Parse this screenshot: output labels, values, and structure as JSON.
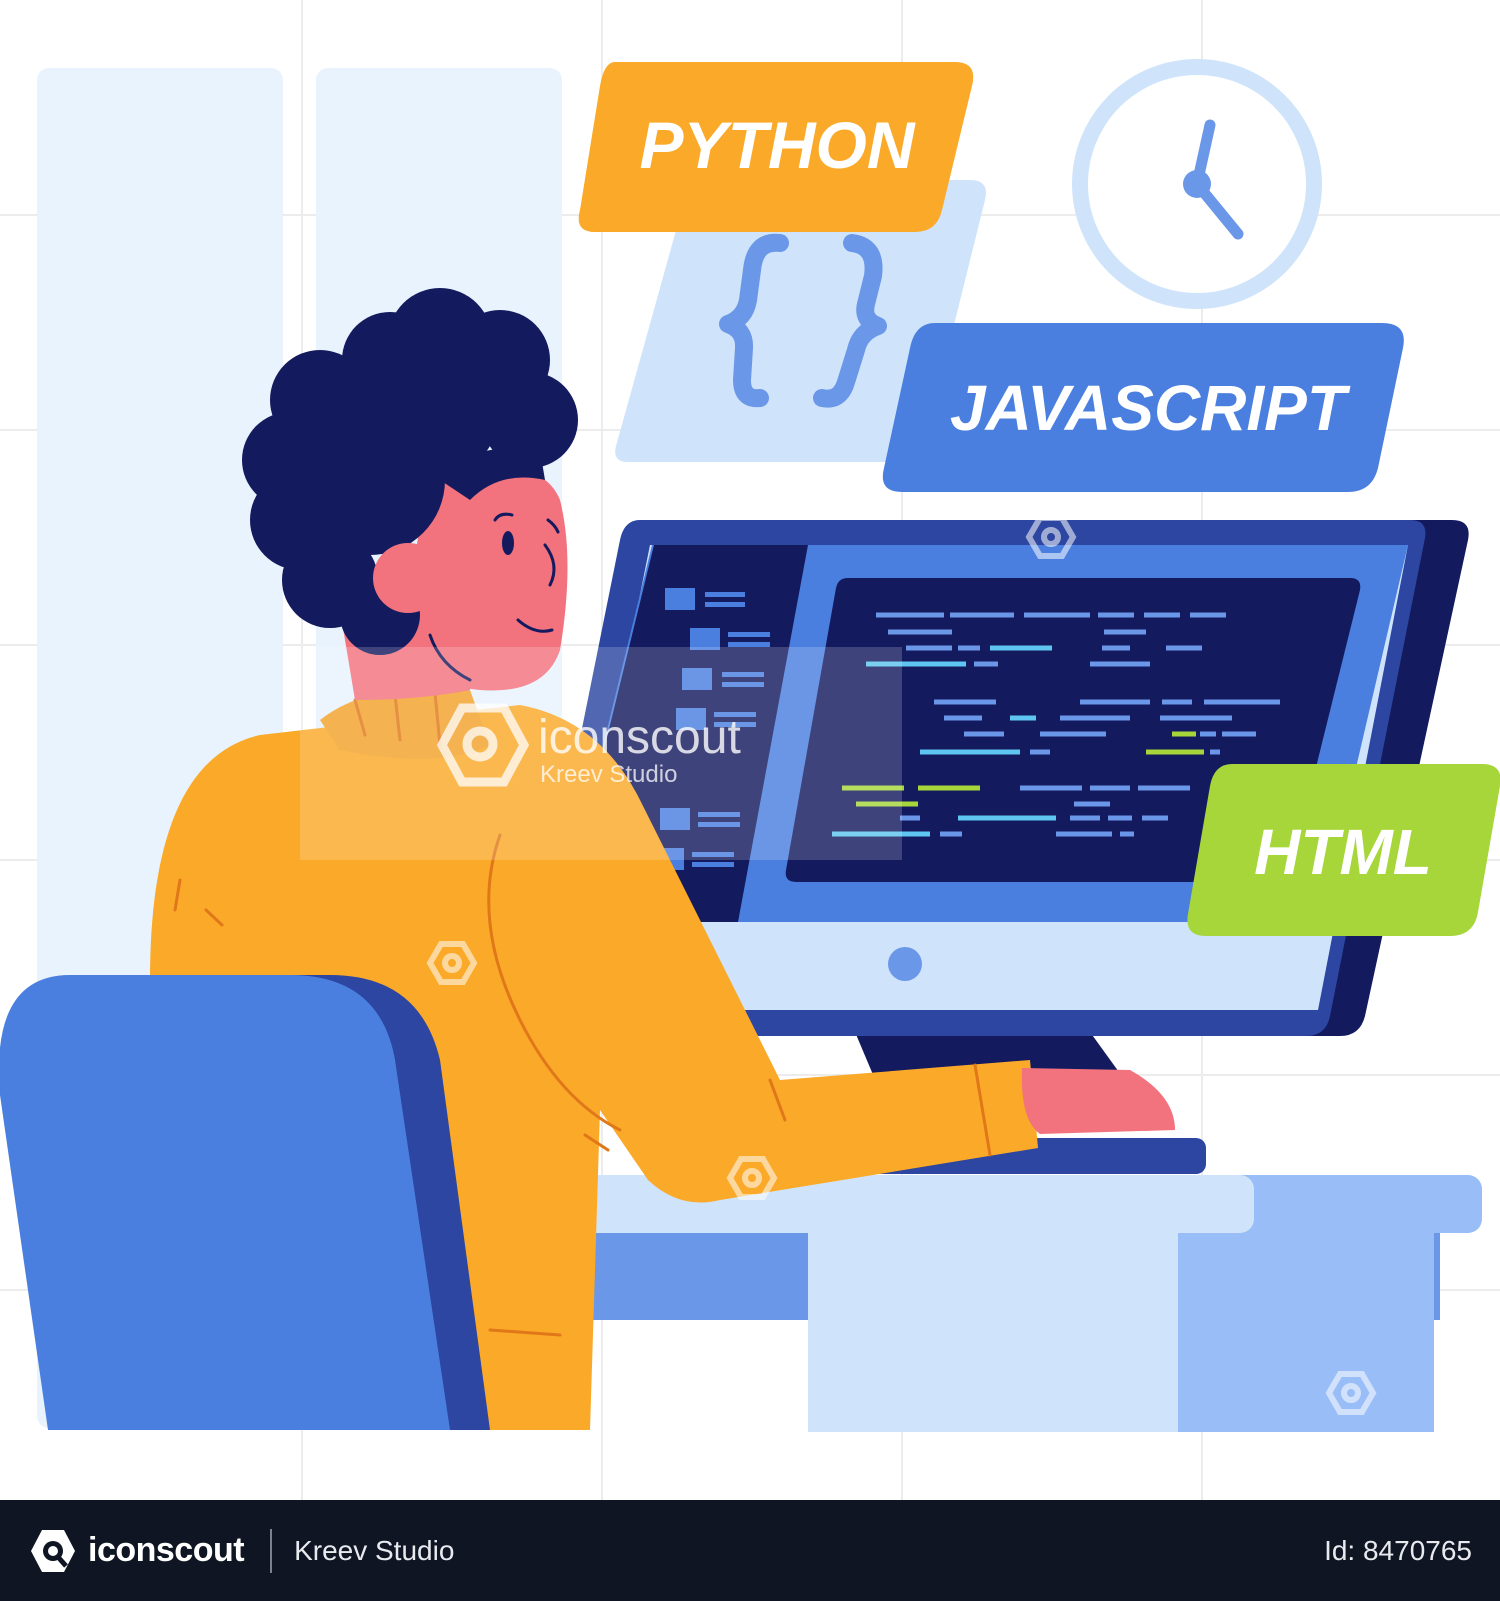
{
  "tags": {
    "python": "PYTHON",
    "javascript": "JAVASCRIPT",
    "html": "HTML"
  },
  "watermark": {
    "brand": "iconscout",
    "author": "Kreev Studio"
  },
  "footer": {
    "brand": "iconscout",
    "author": "Kreev Studio",
    "id_text": "Id: 8470765"
  },
  "colors": {
    "python_tag": "#fba928",
    "javascript_tag": "#4a7fe0",
    "html_tag": "#a6d63a",
    "sweater": "#fba928",
    "hair": "#141a5e",
    "skin": "#f2727e",
    "monitor_frame": "#2c46a1",
    "screen": "#141a5e",
    "chair": "#4a7fe0",
    "desk": "#cfe4fb",
    "footer_bg": "#0f1523"
  },
  "icons": [
    "curly-braces-icon",
    "clock-icon",
    "iconscout-logo-icon"
  ]
}
